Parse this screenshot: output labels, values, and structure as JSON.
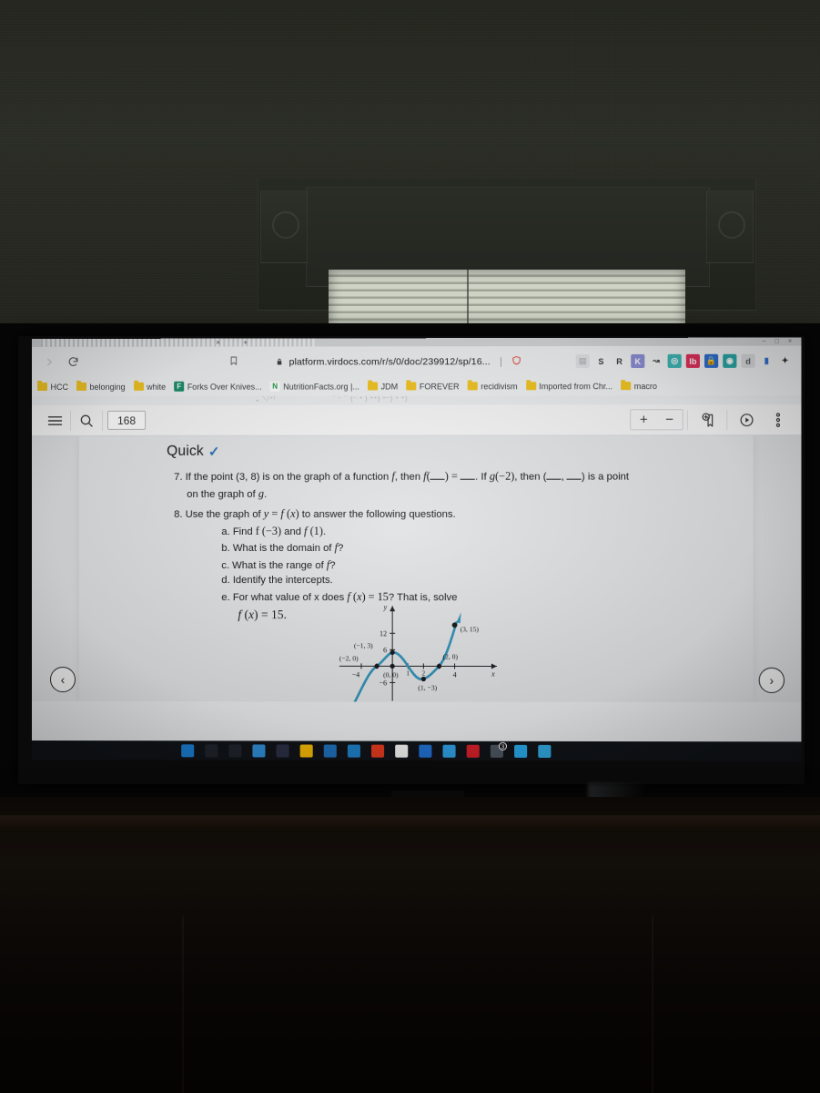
{
  "scene": {
    "description": "photo-of-monitor-in-dark-room"
  },
  "browser": {
    "back_icon": "back-arrow-icon",
    "reload_icon": "reload-icon",
    "bookmark_icon": "bookmark-outline-icon",
    "lock_icon": "lock-icon",
    "url": "platform.virdocs.com/r/s/0/doc/239912/sp/16...",
    "tab_close_glyph": "×",
    "tab_new_glyph": "+",
    "window_controls": "− □ ×",
    "extensions": [
      {
        "name": "extension-grey-box",
        "label": "▤",
        "bg": "#e3e4e6",
        "fg": "#b9bcc0"
      },
      {
        "name": "extension-s",
        "label": "S",
        "bg": "#f1f2f3",
        "fg": "#3c4043"
      },
      {
        "name": "extension-r",
        "label": "R",
        "bg": "#f1f2f3",
        "fg": "#3c4043"
      },
      {
        "name": "extension-k-purple",
        "label": "K",
        "bg": "#8d8fd6",
        "fg": "#ffffff"
      },
      {
        "name": "extension-cursor",
        "label": "↝",
        "bg": "#f1f2f3",
        "fg": "#3c4043"
      },
      {
        "name": "extension-teal-check",
        "label": "◎",
        "bg": "#3fb6b6",
        "fg": "#ffffff"
      },
      {
        "name": "extension-lastpass",
        "label": "lb",
        "bg": "#e0315b",
        "fg": "#ffffff"
      },
      {
        "name": "extension-lock-blue",
        "label": "🔒",
        "bg": "#2f6fd0",
        "fg": "#ffffff"
      },
      {
        "name": "extension-target-teal",
        "label": "◉",
        "bg": "#2aa7a7",
        "fg": "#ffffff"
      },
      {
        "name": "extension-d-grey",
        "label": "d",
        "bg": "#dcdde0",
        "fg": "#55585c"
      },
      {
        "name": "extension-bars-blue",
        "label": "▮",
        "bg": "#f1f2f3",
        "fg": "#2f6fd0"
      },
      {
        "name": "extensions-puzzle-icon",
        "label": "✦",
        "bg": "#f1f2f3",
        "fg": "#2b2b2b"
      }
    ],
    "bookmarks": [
      {
        "label": "HCC",
        "type": "folder"
      },
      {
        "label": "belonging",
        "type": "folder"
      },
      {
        "label": "white",
        "type": "folder"
      },
      {
        "label": "Forks Over Knives...",
        "type": "site",
        "fav": "F",
        "color": "#1c8f6b"
      },
      {
        "label": "NutritionFacts.org |...",
        "type": "site",
        "fav": "N",
        "color": "#ffffff",
        "fg": "#1f9b4a"
      },
      {
        "label": "JDM",
        "type": "folder"
      },
      {
        "label": "FOREVER",
        "type": "folder"
      },
      {
        "label": "recidivism",
        "type": "folder"
      },
      {
        "label": "Imported from Chr...",
        "type": "folder"
      },
      {
        "label": "macro",
        "type": "folder"
      }
    ]
  },
  "reader": {
    "menu_icon": "hamburger-menu-icon",
    "search_icon": "search-icon",
    "page_number": "168",
    "zoom_in_label": "+",
    "zoom_out_label": "−",
    "add_bookmark_icon": "add-bookmark-icon",
    "read_aloud_icon": "play-circle-icon",
    "more_icon": "more-vertical-icon",
    "prev_page_glyph": "‹",
    "next_page_glyph": "›"
  },
  "document": {
    "section_heading": "Quick",
    "section_check": "✓",
    "items": [
      {
        "number": "7.",
        "parts": [
          "If the point (3, 8) is on the graph of a function ",
          "f",
          ", then ",
          "f(__) = __",
          ". If ",
          "g(−2)",
          ", then (__, __) is a point on the graph of ",
          "g",
          "."
        ],
        "plain": "7. If the point (3, 8) is on the graph of a function f, then f(__) = __. If g(−2), then (__, __) is a point on the graph of g."
      },
      {
        "number": "8.",
        "plain": "8. Use the graph of y = f (x) to answer the following questions.",
        "stem_lead": "Use the graph of ",
        "stem_math": "y = f (x)",
        "stem_tail": " to answer the following questions.",
        "subparts": [
          {
            "letter": "a.",
            "lead": "Find ",
            "math": "f (−3)",
            "mid": " and ",
            "math2": "f (1)",
            "tail": "."
          },
          {
            "letter": "b.",
            "lead": "What is the domain of ",
            "math": "f",
            "tail": "?"
          },
          {
            "letter": "c.",
            "lead": "What is the range of ",
            "math": "f",
            "tail": "?"
          },
          {
            "letter": "d.",
            "lead": "Identify the intercepts.",
            "math": "",
            "tail": ""
          },
          {
            "letter": "e.",
            "lead": "For what value of x does ",
            "math": "f (x) = 15",
            "tail": "? That is, solve"
          }
        ],
        "trailing_equation": "f (x) = 15."
      }
    ]
  },
  "chart_data": {
    "type": "line",
    "title": "",
    "xlabel": "x",
    "ylabel": "y",
    "xlim": [
      -5,
      5
    ],
    "ylim": [
      -7,
      18
    ],
    "xticks": [
      -4,
      4
    ],
    "yticks": [
      -6,
      6,
      12
    ],
    "grid": false,
    "curve_color": "#2f8fb5",
    "points": [
      {
        "x": -2,
        "y": 0,
        "label": "(−2, 0)"
      },
      {
        "x": -1,
        "y": 3,
        "label": "(−1, 3)"
      },
      {
        "x": 0,
        "y": 0,
        "label": "(0, 0)"
      },
      {
        "x": 1,
        "y": -3,
        "label": "(1, −3)"
      },
      {
        "x": 2,
        "y": 0,
        "label": "(2, 0)"
      },
      {
        "x": 3,
        "y": 15,
        "label": "(3, 15)"
      }
    ],
    "description": "Cubic-like curve y = f(x) rising through labeled points"
  },
  "taskbar": {
    "items": [
      {
        "name": "start-button",
        "glyph": "⊞",
        "color": "#1b7fd4"
      },
      {
        "name": "search-icon",
        "glyph": "○",
        "color": "#20242b"
      },
      {
        "name": "task-view-icon",
        "glyph": "▯",
        "color": "#20242b"
      },
      {
        "name": "edge-icon",
        "glyph": "▤",
        "color": "#2f8ed6"
      },
      {
        "name": "app-dark-circle-icon",
        "glyph": "◉",
        "color": "#2b2f45"
      },
      {
        "name": "file-explorer-icon",
        "glyph": "▬",
        "color": "#f2b705"
      },
      {
        "name": "store-icon",
        "glyph": "▦",
        "color": "#1f6fb8"
      },
      {
        "name": "mail-icon",
        "glyph": "✉",
        "color": "#1e7fc4"
      },
      {
        "name": "brave-icon",
        "glyph": "▼",
        "color": "#e03a1e"
      },
      {
        "name": "xbox-icon",
        "glyph": "✕",
        "color": "#f2f2f2"
      },
      {
        "name": "chrome-icon",
        "glyph": "◎",
        "color": "#1f6fd0"
      },
      {
        "name": "blue-app-icon",
        "glyph": "▮",
        "color": "#2f9ee0"
      },
      {
        "name": "red-app-icon",
        "glyph": "▰",
        "color": "#d3202a"
      },
      {
        "name": "notes-icon",
        "glyph": "▣",
        "color": "#4c5560",
        "badge": "3"
      },
      {
        "name": "skype-icon",
        "glyph": "S",
        "color": "#27a8e8"
      },
      {
        "name": "telegram-icon",
        "glyph": "➤",
        "color": "#31a8e0"
      }
    ]
  }
}
